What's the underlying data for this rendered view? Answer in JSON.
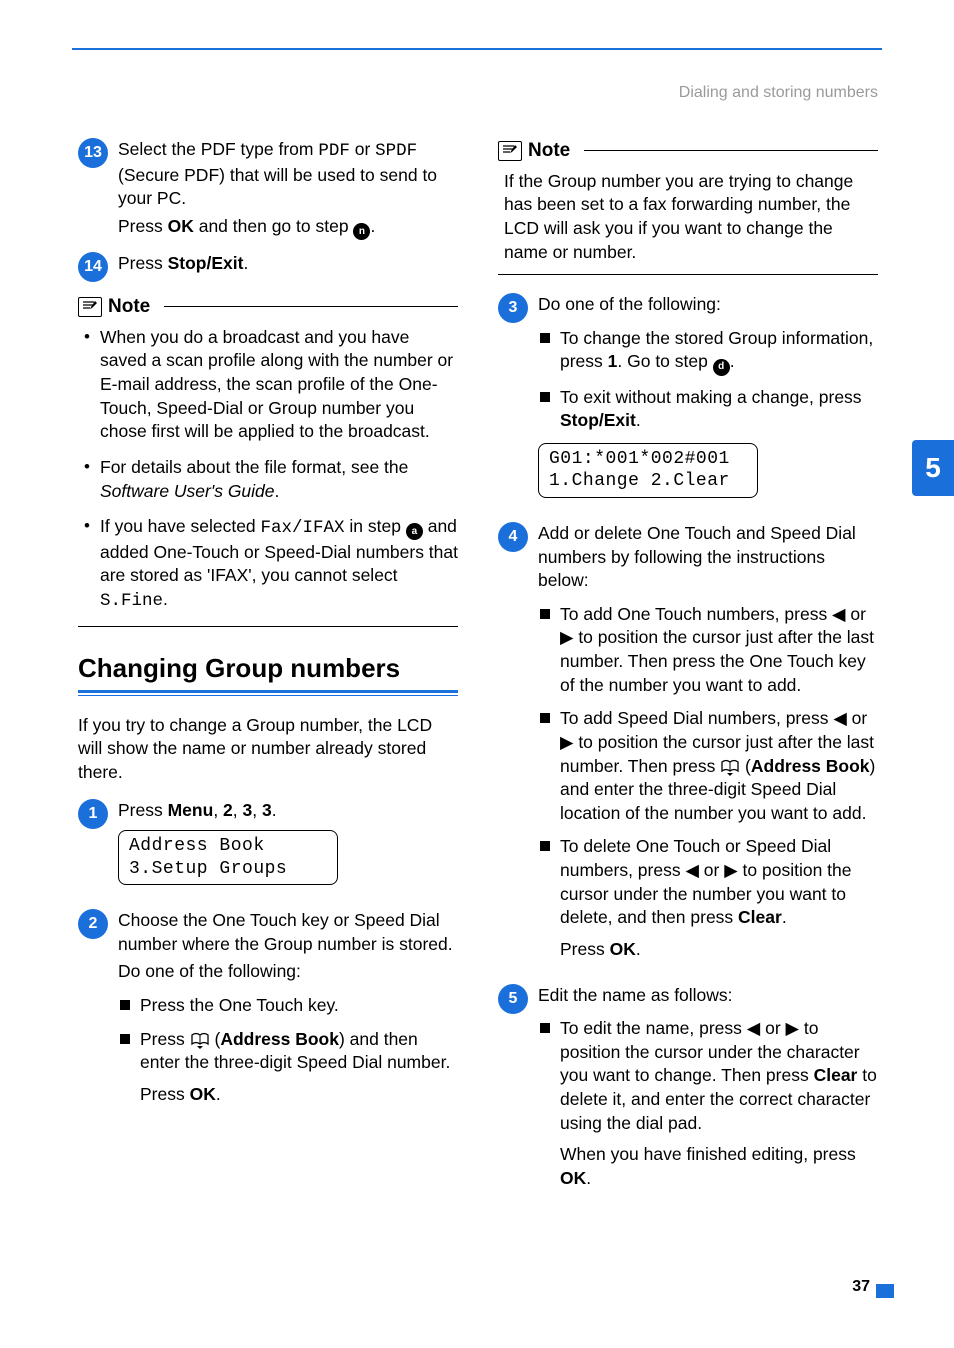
{
  "header": {
    "breadcrumb": "Dialing and storing numbers"
  },
  "sideTab": {
    "label": "5"
  },
  "footer": {
    "page": "37"
  },
  "left": {
    "step13": {
      "num": "13",
      "line1a": "Select the PDF type from ",
      "code1": "PDF",
      "line1b": " or ",
      "code2": "SPDF",
      "line2": " (Secure PDF) that will be used to send to your PC.",
      "line3a": "Press ",
      "bold3": "OK",
      "line3b": " and then go to step ",
      "ref3": "n",
      "line3c": "."
    },
    "step14": {
      "num": "14",
      "textA": "Press ",
      "bold": "Stop/Exit",
      "textB": "."
    },
    "note1": {
      "title": "Note",
      "b1": "When you do a broadcast and you have saved a scan profile along with the number or E-mail address, the scan profile of the One-Touch, Speed-Dial or Group number you chose first will be applied to the broadcast.",
      "b2a": "For details about the file format, see the ",
      "b2i": "Software User's Guide",
      "b2c": ".",
      "b3a": "If you have selected ",
      "b3code": "Fax/IFAX",
      "b3b": " in step ",
      "b3ref": "a",
      "b3c": " and added One-Touch or Speed-Dial numbers that are stored as 'IFAX', you cannot select ",
      "b3code2": "S.Fine",
      "b3d": "."
    },
    "heading": "Changing Group numbers",
    "intro": "If you try to change a Group number, the LCD will show the name or number already stored there.",
    "step1": {
      "num": "1",
      "a": "Press ",
      "b": "Menu",
      "c": ", ",
      "d": "2",
      "e": ", ",
      "f": "3",
      "g": ", ",
      "h": "3",
      "i": ".",
      "lcd": "Address Book\n3.Setup Groups"
    },
    "step2": {
      "num": "2",
      "p1": "Choose the One Touch key or Speed Dial number where the Group number is stored.",
      "p2": "Do one of the following:",
      "li1": "Press the One Touch key.",
      "li2a": "Press ",
      "li2b": " (",
      "li2bold": "Address Book",
      "li2c": ") and then enter the three-digit Speed Dial number.",
      "li2d": "Press ",
      "li2ok": "OK",
      "li2e": "."
    }
  },
  "right": {
    "note2": {
      "title": "Note",
      "body": "If the Group number you are trying to change has been set to a fax forwarding number, the LCD will ask you if you want to change the name or number."
    },
    "step3": {
      "num": "3",
      "lead": "Do one of the following:",
      "li1a": "To change the stored Group information, press ",
      "li1b": "1",
      "li1c": ". Go to step ",
      "li1ref": "d",
      "li1d": ".",
      "li2a": "To exit without making a change, press ",
      "li2b": "Stop/Exit",
      "li2c": ".",
      "lcd": "G01:*001*002#001\n1.Change 2.Clear"
    },
    "step4": {
      "num": "4",
      "lead": "Add or delete One Touch and Speed Dial numbers by following the instructions below:",
      "li1": "To add One Touch numbers, press ◀ or ▶ to position the cursor just after the last number. Then press the One Touch key of the number you want to add.",
      "li2a": "To add Speed Dial numbers, press ◀ or ▶ to position the cursor just after the last number. Then press ",
      "li2b": " (",
      "li2bold": "Address Book",
      "li2c": ") and enter the three-digit Speed Dial location of the number you want to add.",
      "li3a": "To delete One Touch or Speed Dial numbers, press ◀ or ▶ to position the cursor under the number you want to delete, and then press ",
      "li3b": "Clear",
      "li3c": ".",
      "li3d": "Press ",
      "li3ok": "OK",
      "li3e": "."
    },
    "step5": {
      "num": "5",
      "lead": "Edit the name as follows:",
      "li1a": "To edit the name, press ◀ or ▶ to position the cursor under the character you want to change. Then press ",
      "li1b": "Clear",
      "li1c": " to delete it, and enter the correct character using the dial pad.",
      "li1d": "When you have finished editing, press ",
      "li1ok": "OK",
      "li1e": "."
    }
  }
}
